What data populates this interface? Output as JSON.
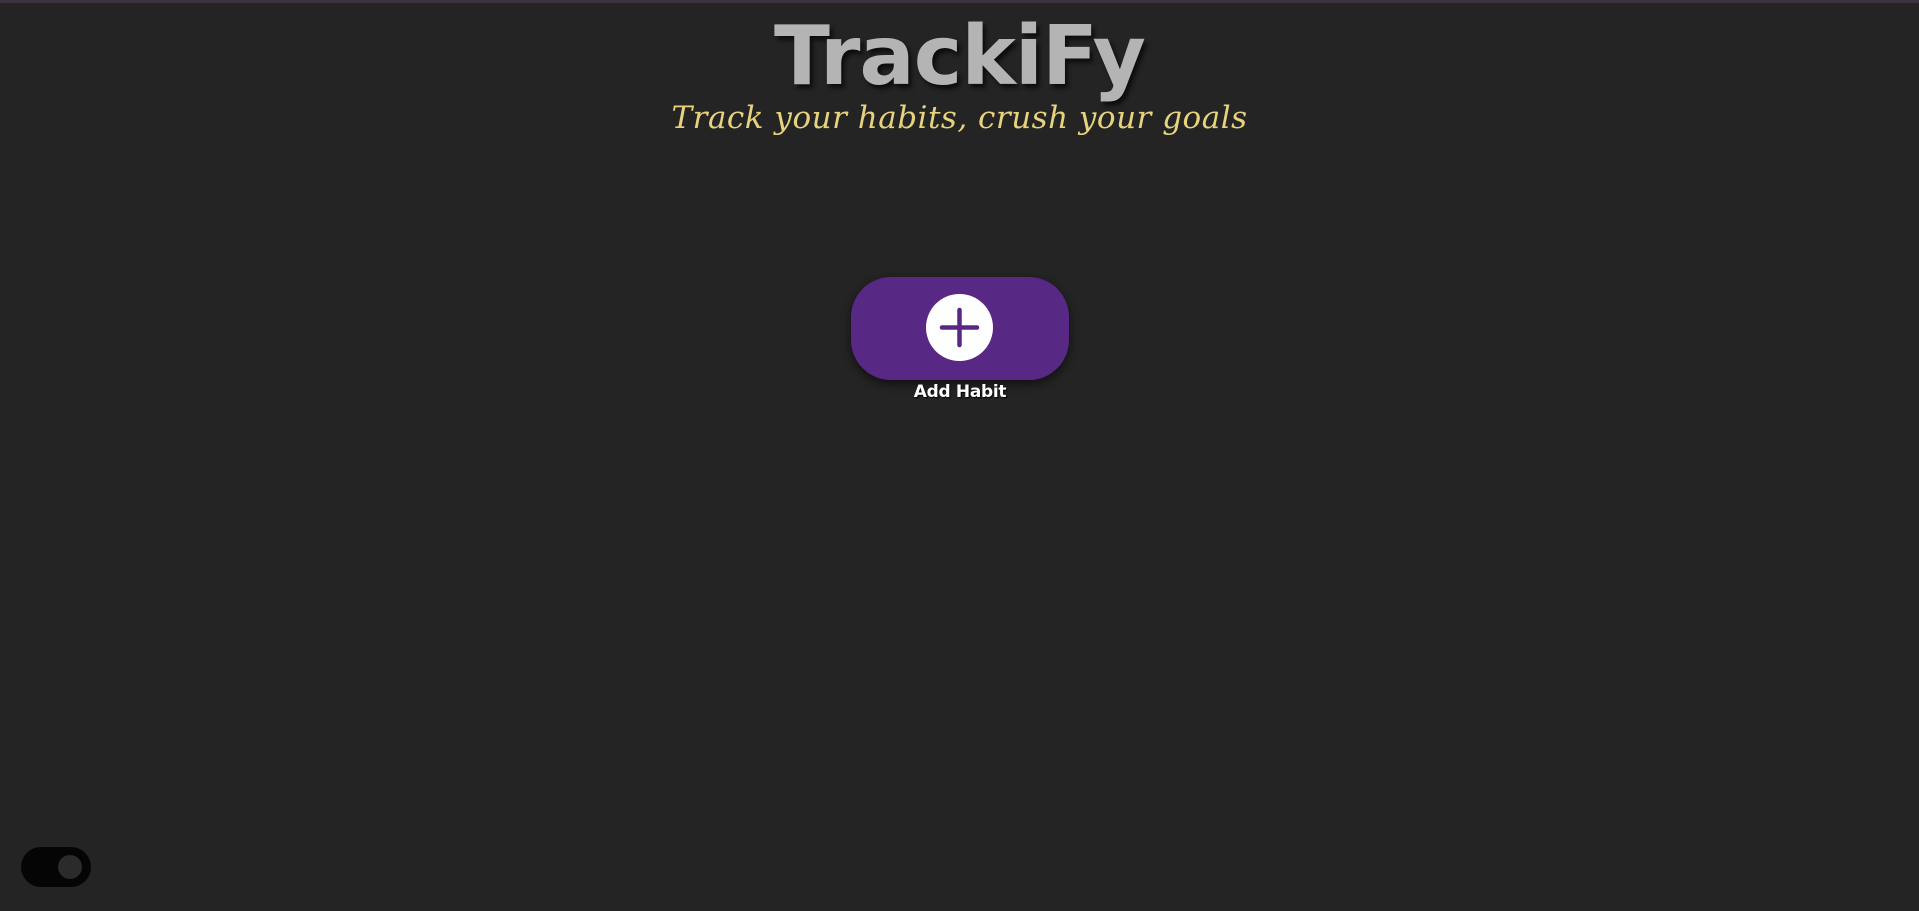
{
  "header": {
    "title": "TrackiFy",
    "subtitle": "Track your habits, crush your goals"
  },
  "add_habit": {
    "label": "Add Habit",
    "icon": "plus-icon"
  },
  "theme_toggle": {
    "icon": "toggle-switch",
    "state": "on"
  },
  "colors": {
    "background": "#242424",
    "title": "#b4b4b4",
    "subtitle": "#e7d37d",
    "accent": "#582885",
    "toggle": "#050505"
  }
}
